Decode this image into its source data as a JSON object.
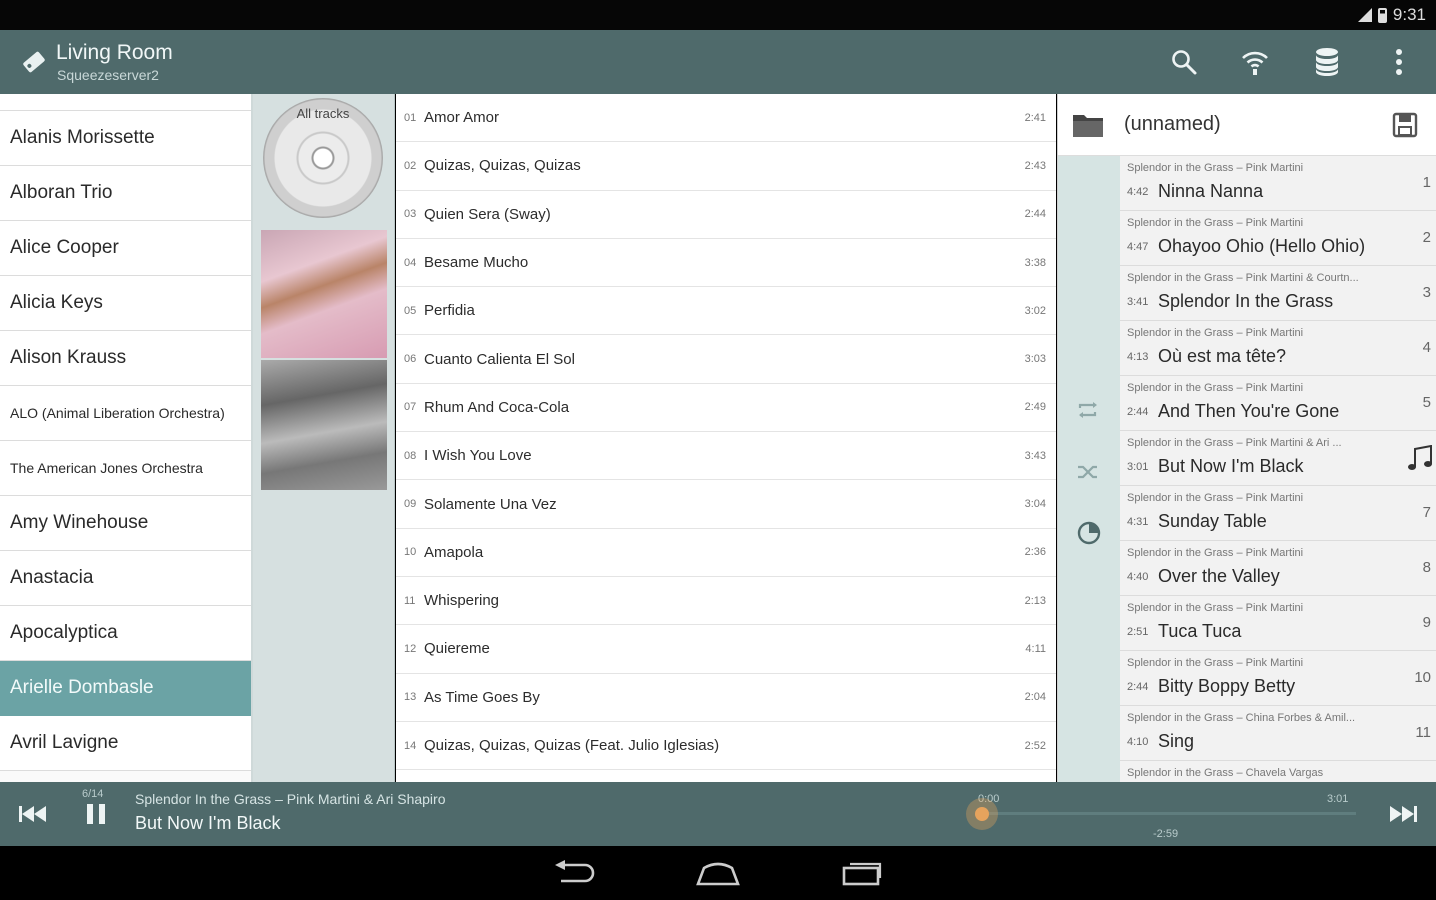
{
  "status_bar": {
    "time": "9:31"
  },
  "header": {
    "title": "Living Room",
    "subtitle": "Squeezeserver2"
  },
  "artists": [
    "Alanis Morissette",
    "Alboran Trio",
    "Alice Cooper",
    "Alicia Keys",
    "Alison Krauss",
    "ALO (Animal Liberation Orchestra)",
    "The American Jones Orchestra",
    "Amy Winehouse",
    "Anastacia",
    "Apocalyptica",
    "Arielle Dombasle",
    "Avril Lavigne"
  ],
  "selected_artist": "Arielle Dombasle",
  "albums": {
    "all_tracks_label": "All tracks"
  },
  "tracks": [
    {
      "num": "01",
      "title": "Amor Amor",
      "duration": "2:41"
    },
    {
      "num": "02",
      "title": "Quizas, Quizas, Quizas",
      "duration": "2:43"
    },
    {
      "num": "03",
      "title": "Quien Sera (Sway)",
      "duration": "2:44"
    },
    {
      "num": "04",
      "title": "Besame Mucho",
      "duration": "3:38"
    },
    {
      "num": "05",
      "title": "Perfidia",
      "duration": "3:02"
    },
    {
      "num": "06",
      "title": "Cuanto Calienta El Sol",
      "duration": "3:03"
    },
    {
      "num": "07",
      "title": "Rhum And Coca-Cola",
      "duration": "2:49"
    },
    {
      "num": "08",
      "title": "I Wish You Love",
      "duration": "3:43"
    },
    {
      "num": "09",
      "title": "Solamente Una Vez",
      "duration": "3:04"
    },
    {
      "num": "10",
      "title": "Amapola",
      "duration": "2:36"
    },
    {
      "num": "11",
      "title": "Whispering",
      "duration": "2:13"
    },
    {
      "num": "12",
      "title": "Quiereme",
      "duration": "4:11"
    },
    {
      "num": "13",
      "title": "As Time Goes By",
      "duration": "2:04"
    },
    {
      "num": "14",
      "title": "Quizas, Quizas, Quizas (Feat. Julio Iglesias)",
      "duration": "2:52"
    }
  ],
  "queue": {
    "playlist_name": "(unnamed)",
    "items": [
      {
        "sub": "Splendor in the Grass – Pink Martini",
        "duration": "4:42",
        "title": "Ninna Nanna",
        "index": "1"
      },
      {
        "sub": "Splendor in the Grass – Pink Martini",
        "duration": "4:47",
        "title": "Ohayoo Ohio (Hello Ohio)",
        "index": "2"
      },
      {
        "sub": "Splendor in the Grass – Pink Martini & Courtn...",
        "duration": "3:41",
        "title": "Splendor In the Grass",
        "index": "3"
      },
      {
        "sub": "Splendor in the Grass – Pink Martini",
        "duration": "4:13",
        "title": "Où est ma tête?",
        "index": "4"
      },
      {
        "sub": "Splendor in the Grass – Pink Martini",
        "duration": "2:44",
        "title": "And Then You're Gone",
        "index": "5"
      },
      {
        "sub": "Splendor in the Grass – Pink Martini & Ari ...",
        "duration": "3:01",
        "title": "But Now I'm Black",
        "index": ""
      },
      {
        "sub": "Splendor in the Grass – Pink Martini",
        "duration": "4:31",
        "title": "Sunday Table",
        "index": "7"
      },
      {
        "sub": "Splendor in the Grass – Pink Martini",
        "duration": "4:40",
        "title": "Over the Valley",
        "index": "8"
      },
      {
        "sub": "Splendor in the Grass – Pink Martini",
        "duration": "2:51",
        "title": "Tuca Tuca",
        "index": "9"
      },
      {
        "sub": "Splendor in the Grass – Pink Martini",
        "duration": "2:44",
        "title": "Bitty Boppy Betty",
        "index": "10"
      },
      {
        "sub": "Splendor in the Grass – China Forbes & Amil...",
        "duration": "4:10",
        "title": "Sing",
        "index": "11"
      },
      {
        "sub": "Splendor in the Grass – Chavela Vargas",
        "duration": "",
        "title": "",
        "index": ""
      }
    ]
  },
  "now_playing": {
    "count": "6/14",
    "album_artist": "Splendor In the Grass – Pink Martini & Ari Shapiro",
    "title": "But Now I'm Black",
    "elapsed": "0:00",
    "total": "3:01",
    "remaining": "-2:59",
    "progress": 0.0
  },
  "colors": {
    "bar": "#4f6a6b",
    "accent": "#6ba3a5",
    "knob": "#e6a35d"
  }
}
